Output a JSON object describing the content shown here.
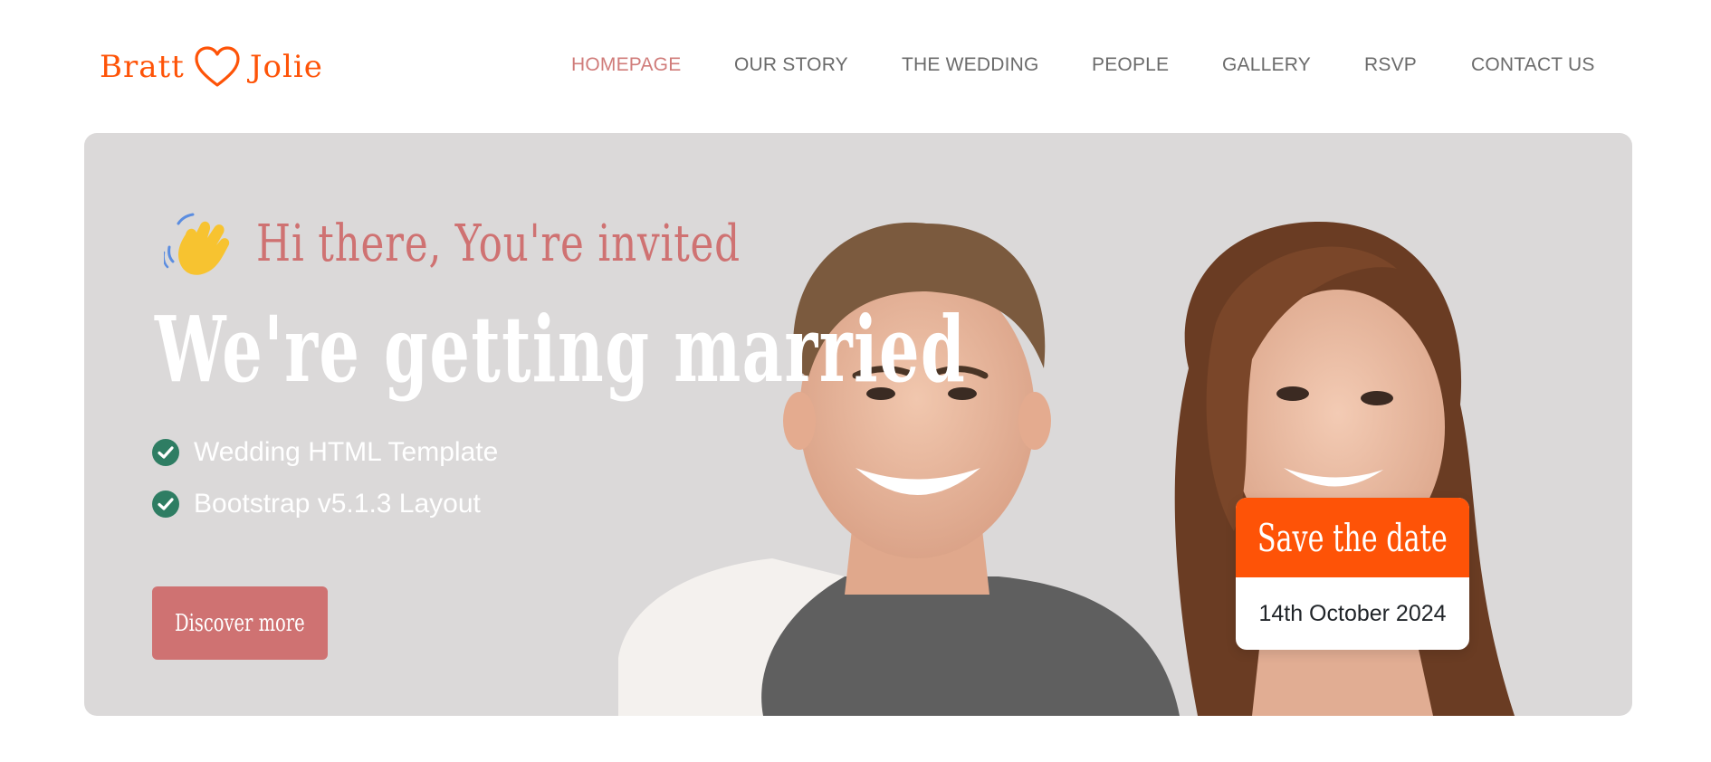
{
  "logo": {
    "left": "Bratt",
    "right": "Jolie",
    "icon": "heart-outline-icon",
    "color": "#fe5307"
  },
  "nav": {
    "items": [
      {
        "label": "HOMEPAGE",
        "active": true
      },
      {
        "label": "OUR STORY",
        "active": false
      },
      {
        "label": "THE WEDDING",
        "active": false
      },
      {
        "label": "PEOPLE",
        "active": false
      },
      {
        "label": "GALLERY",
        "active": false
      },
      {
        "label": "RSVP",
        "active": false
      },
      {
        "label": "CONTACT US",
        "active": false
      }
    ],
    "active_color": "#d07c7a"
  },
  "hero": {
    "greeting": "Hi there, You're invited",
    "greeting_icon": "waving-hand-icon",
    "title": "We're getting married",
    "features": [
      "Wedding HTML Template",
      "Bootstrap v5.1.3 Layout"
    ],
    "feature_icon": "check-circle-icon",
    "cta_label": "Discover more",
    "background": "#dbd9d9",
    "accent": "#cf7272"
  },
  "save_the_date": {
    "heading": "Save the date",
    "date": "14th October 2024",
    "color": "#fe5307"
  }
}
